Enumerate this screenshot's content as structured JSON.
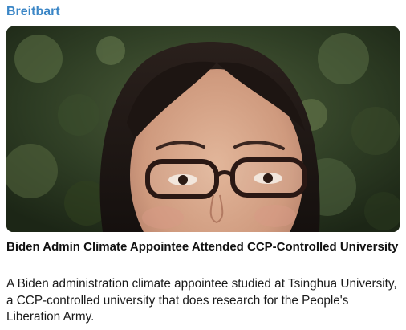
{
  "source": {
    "name": "Breitbart",
    "color": "#3b86c6"
  },
  "article": {
    "image_icon": "portrait-photo",
    "headline": "Biden Admin Climate Appointee Attended CCP-Controlled University",
    "summary": "A Biden administration climate appointee studied at Tsinghua University, a CCP-controlled university that does research for the People's Liberation Army."
  }
}
